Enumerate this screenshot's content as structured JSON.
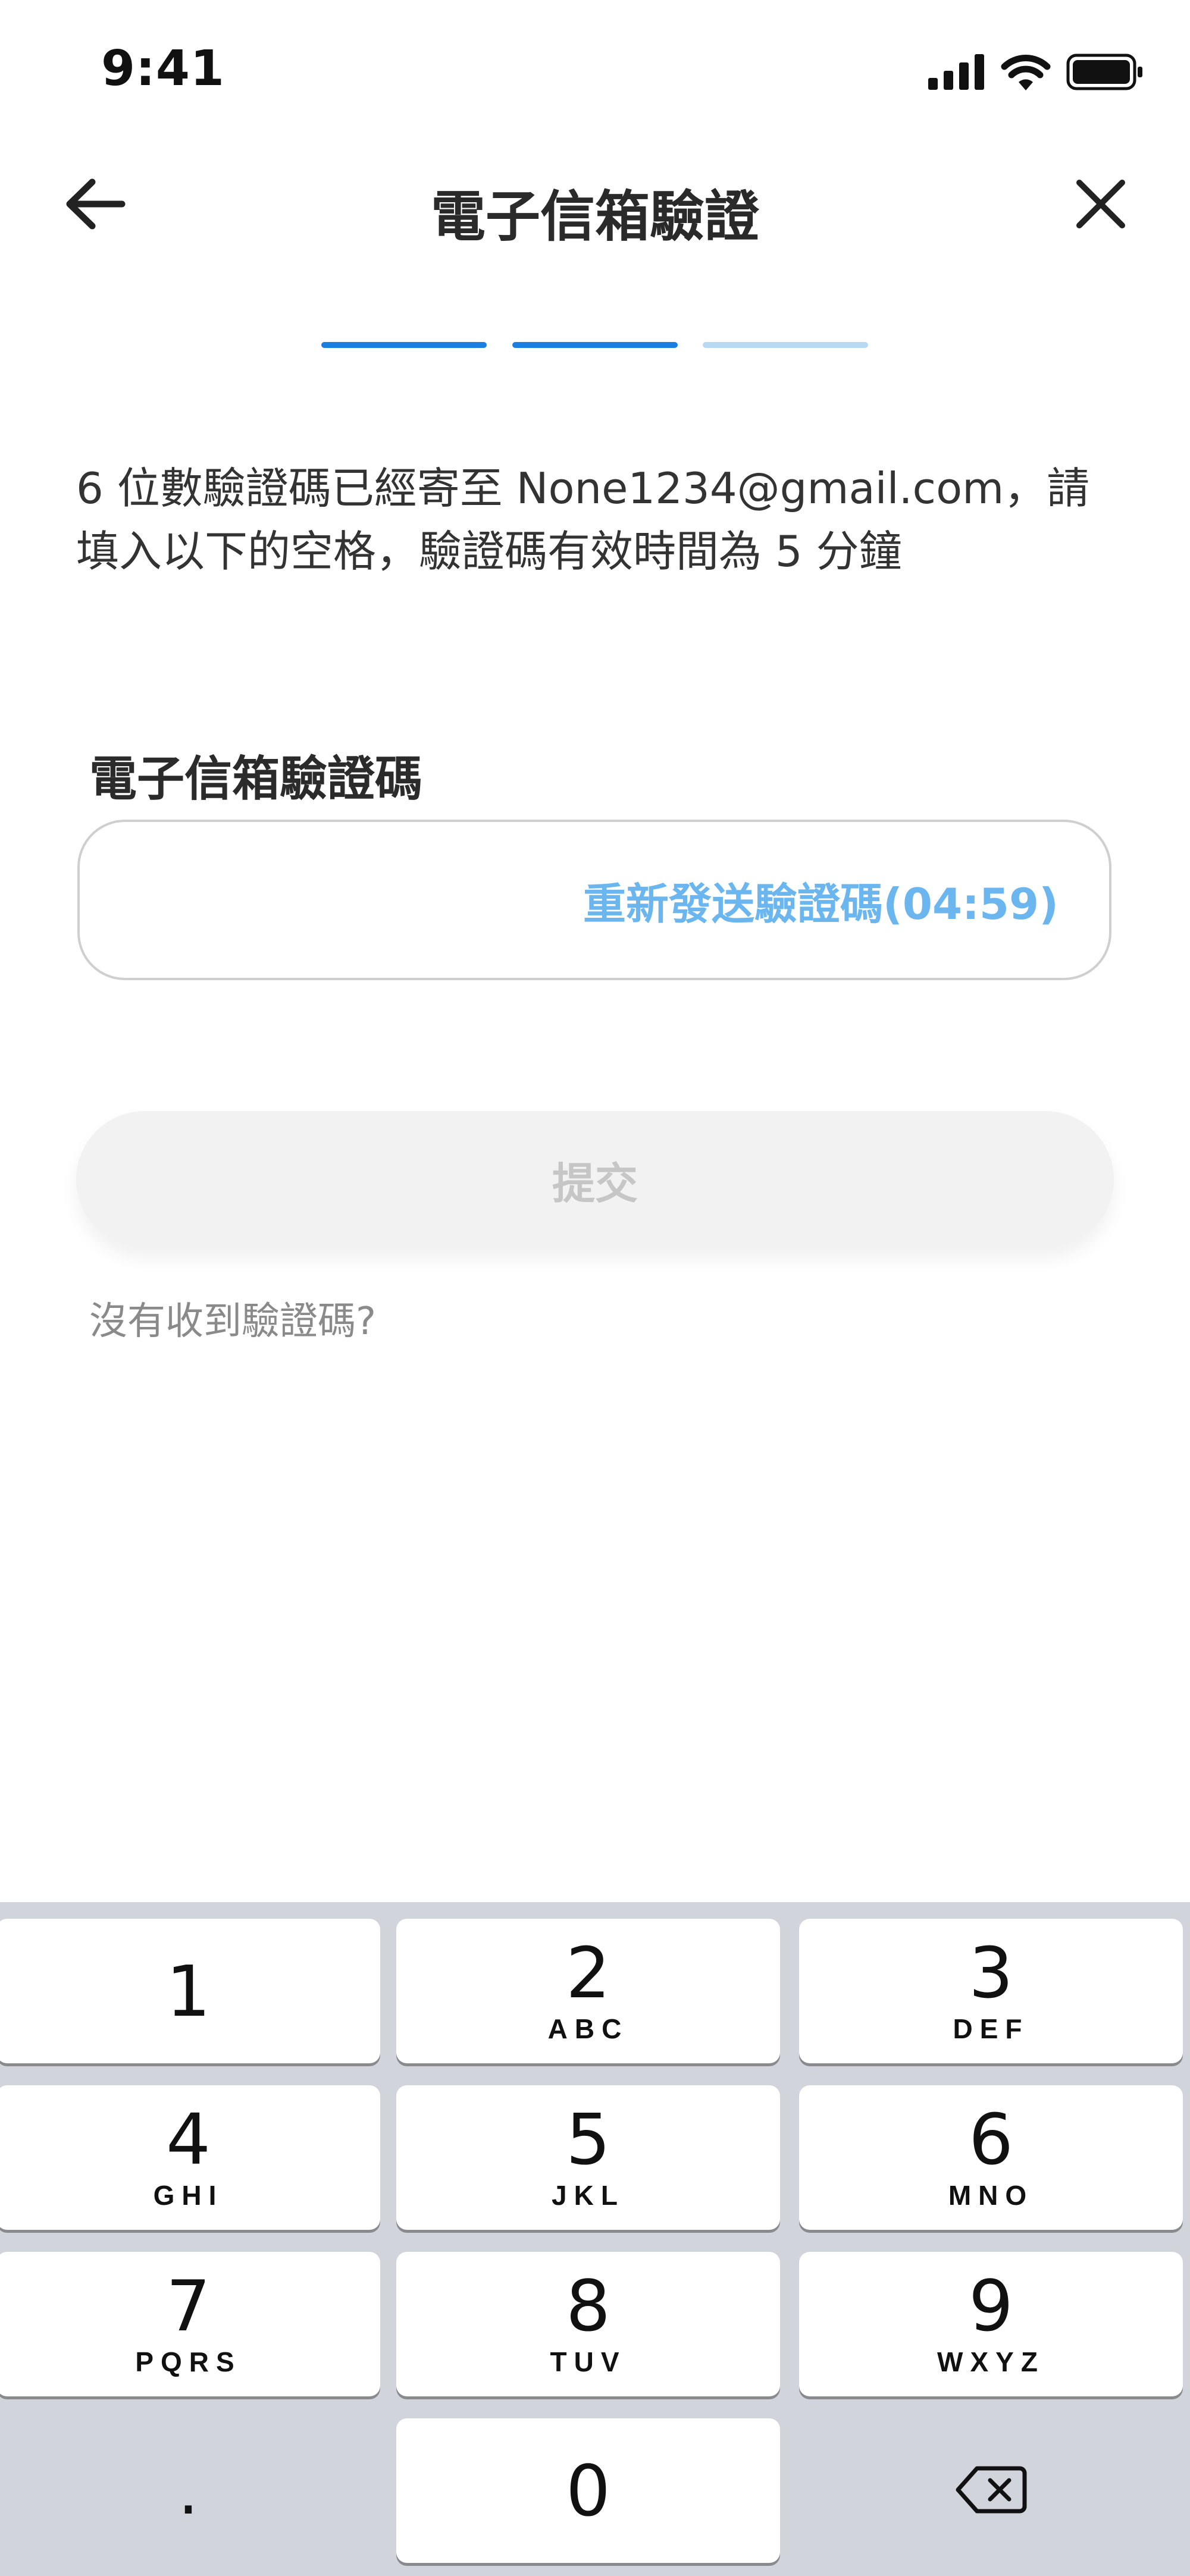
{
  "status_bar": {
    "time": "9:41"
  },
  "header": {
    "title": "電子信箱驗證"
  },
  "stepper": {
    "steps": [
      {
        "state": "complete",
        "color": "#1a7fe0"
      },
      {
        "state": "current",
        "color": "#1a7fe0"
      },
      {
        "state": "upcoming",
        "color": "#b7d9f4"
      }
    ]
  },
  "description": "6 位數驗證碼已經寄至 None1234@gmail.com，請填入以下的空格，驗證碼有效時間為 5 分鐘",
  "field": {
    "label": "電子信箱驗證碼",
    "value": "",
    "resend_label": "重新發送驗證碼(04:59)"
  },
  "submit_label": "提交",
  "no_code_link": "沒有收到驗證碼?",
  "keyboard": {
    "keys": [
      {
        "num": "1",
        "letters": ""
      },
      {
        "num": "2",
        "letters": "ABC"
      },
      {
        "num": "3",
        "letters": "DEF"
      },
      {
        "num": "4",
        "letters": "GHI"
      },
      {
        "num": "5",
        "letters": "JKL"
      },
      {
        "num": "6",
        "letters": "MNO"
      },
      {
        "num": "7",
        "letters": "PQRS"
      },
      {
        "num": "8",
        "letters": "TUV"
      },
      {
        "num": "9",
        "letters": "WXYZ"
      },
      {
        "num": ".",
        "letters": ""
      },
      {
        "num": "0",
        "letters": ""
      }
    ]
  },
  "colors": {
    "accent": "#1a7fe0",
    "accent_light": "#b7d9f4",
    "resend_link": "#6cb6ef",
    "keyboard_bg": "#d1d5db",
    "submit_disabled_bg": "#f2f2f2",
    "submit_disabled_text": "#c6c6c6"
  },
  "icons": {
    "back": "arrow-left-icon",
    "close": "close-icon",
    "signal": "cellular-signal-icon",
    "wifi": "wifi-icon",
    "battery": "battery-icon",
    "backspace": "backspace-icon"
  }
}
